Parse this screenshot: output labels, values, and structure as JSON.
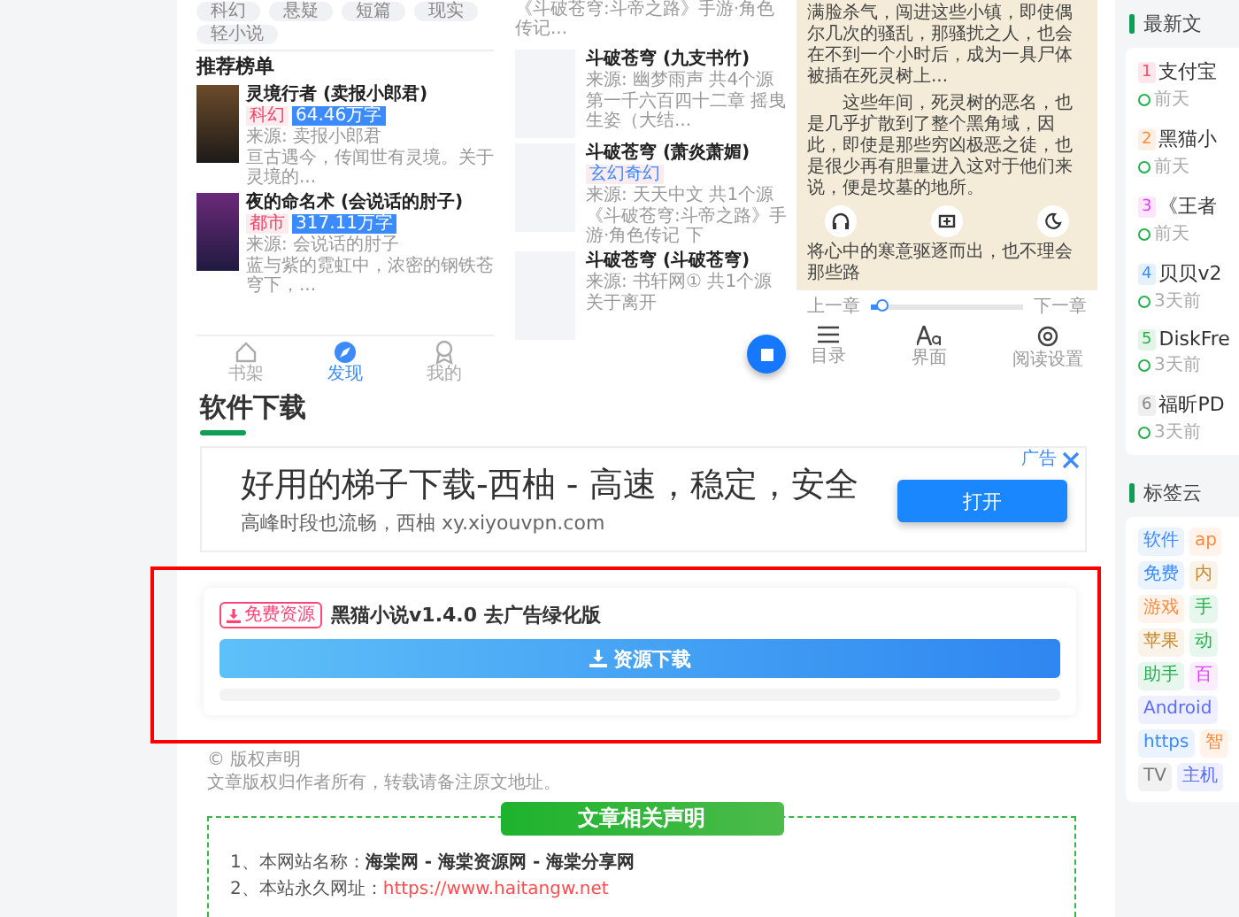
{
  "phone_screens": {
    "library": {
      "genre_tags": [
        "科幻",
        "悬疑",
        "短篇",
        "现实",
        "轻小说"
      ],
      "section_title": "推荐榜单",
      "books": [
        {
          "title": "灵境行者 (卖报小郎君)",
          "category": "科幻",
          "word_count": "64.46万字",
          "source": "来源: 卖报小郎君",
          "summary": "亘古遇今，传闻世有灵境。关于灵境的..."
        },
        {
          "title": "夜的命名术 (会说话的肘子)",
          "category": "都市",
          "word_count": "317.11万字",
          "source": "来源: 会说话的肘子",
          "summary": "蓝与紫的霓虹中，浓密的钢铁苍穹下，..."
        }
      ],
      "nav": [
        {
          "label": "书架",
          "selected": false
        },
        {
          "label": "发现",
          "selected": true
        },
        {
          "label": "我的",
          "selected": false
        }
      ]
    },
    "search_results": {
      "top_line": "《斗破苍穹:斗帝之路》手游·角色传记...",
      "results": [
        {
          "title": "斗破苍穹 (九支书竹)",
          "source": "来源: 幽梦雨声 共4个源",
          "latest": "第一千六百四十二章 摇曳生姿（大结..."
        },
        {
          "title": "斗破苍穹 (萧炎萧媚)",
          "tag": "玄幻奇幻",
          "source": "来源: 天天中文 共1个源",
          "latest": "《斗破苍穹:斗帝之路》手游·角色传记 下"
        },
        {
          "title": "斗破苍穹 (斗破苍穹)",
          "source": "来源: 书轩网① 共1个源",
          "latest": "关于离开"
        }
      ]
    },
    "reader": {
      "paragraphs": [
        {
          "text": "满脸杀气，闯进这些小镇，即使偶尔几次的骚乱，那骚扰之人，也会在不到一个小时后，成为一具尸体被插在死灵树上...",
          "indent": false
        },
        {
          "text": "这些年间，死灵树的恶名，也是几乎扩散到了整个黑角域，因此，即使是那些穷凶极恶之徒，也是很少再有胆量进入这对于他们来说，便是坟墓的地所。",
          "indent": true
        },
        {
          "text": "将心中的寒意驱逐而出，也不理会那些路",
          "indent": false
        }
      ],
      "prev": "上一章",
      "next": "下一章",
      "level": 0.08,
      "menu": [
        {
          "label": "目录",
          "kind": "list"
        },
        {
          "label": "界面",
          "kind": "font"
        },
        {
          "label": "阅读设置",
          "kind": "settings"
        }
      ]
    }
  },
  "section_title": "软件下载",
  "ad": {
    "headline": "好用的梯子下载-西柚 - 高速，稳定，安全",
    "subline": "高峰时段也流畅，西柚 xy.xiyouvpn.com",
    "button": "打开",
    "label": "广告"
  },
  "download": {
    "badge": "免费资源",
    "title": "黑猫小说v1.4.0 去广告绿化版",
    "button": "资源下载"
  },
  "copyright": {
    "title": "© 版权声明",
    "text": "文章版权归作者所有，转载请备注原文地址。"
  },
  "statement": {
    "title": "文章相关声明",
    "lines": [
      {
        "kind": "bold",
        "label": "1、本网站名称：",
        "value": "海棠网 - 海棠资源网 - 海棠分享网"
      },
      {
        "kind": "link",
        "label": "2、本站永久网址：",
        "value": "https://www.haitangw.net"
      }
    ]
  },
  "sidebar": {
    "latest": {
      "title": "最新文",
      "items": [
        {
          "rank": "1",
          "title": "支付宝",
          "time": "前天",
          "color": "#ff4d6a"
        },
        {
          "rank": "2",
          "title": "黑猫小",
          "time": "前天",
          "color": "#ff8a3d"
        },
        {
          "rank": "3",
          "title": "《王者",
          "time": "前天",
          "color": "#e040fb"
        },
        {
          "rank": "4",
          "title": "贝贝v2",
          "time": "3天前",
          "color": "#3b8bff"
        },
        {
          "rank": "5",
          "title": "DiskFre",
          "time": "3天前",
          "color": "#22b14c"
        },
        {
          "rank": "6",
          "title": "福昕PD",
          "time": "3天前",
          "color": "#888888"
        }
      ]
    },
    "tags": {
      "title": "标签云",
      "rows": [
        [
          {
            "label": "软件",
            "color": "#3b8bff"
          },
          {
            "label": "ap",
            "color": "#ff8a3d"
          }
        ],
        [
          {
            "label": "免费",
            "color": "#3b8bff"
          },
          {
            "label": "内",
            "color": "#c98a2b"
          }
        ],
        [
          {
            "label": "游戏",
            "color": "#ff8a3d"
          },
          {
            "label": "手",
            "color": "#22b14c"
          }
        ],
        [
          {
            "label": "苹果",
            "color": "#c98a2b"
          },
          {
            "label": "动",
            "color": "#22b14c"
          }
        ],
        [
          {
            "label": "助手",
            "color": "#22b14c"
          },
          {
            "label": "百",
            "color": "#e040fb"
          }
        ],
        [
          {
            "label": "Android",
            "color": "#5b6cff"
          }
        ],
        [
          {
            "label": "https",
            "color": "#3b8bff"
          },
          {
            "label": "智",
            "color": "#ff8a3d"
          }
        ],
        [
          {
            "label": "TV",
            "color": "#777777"
          },
          {
            "label": "主机",
            "color": "#5b6cff"
          }
        ]
      ]
    }
  }
}
